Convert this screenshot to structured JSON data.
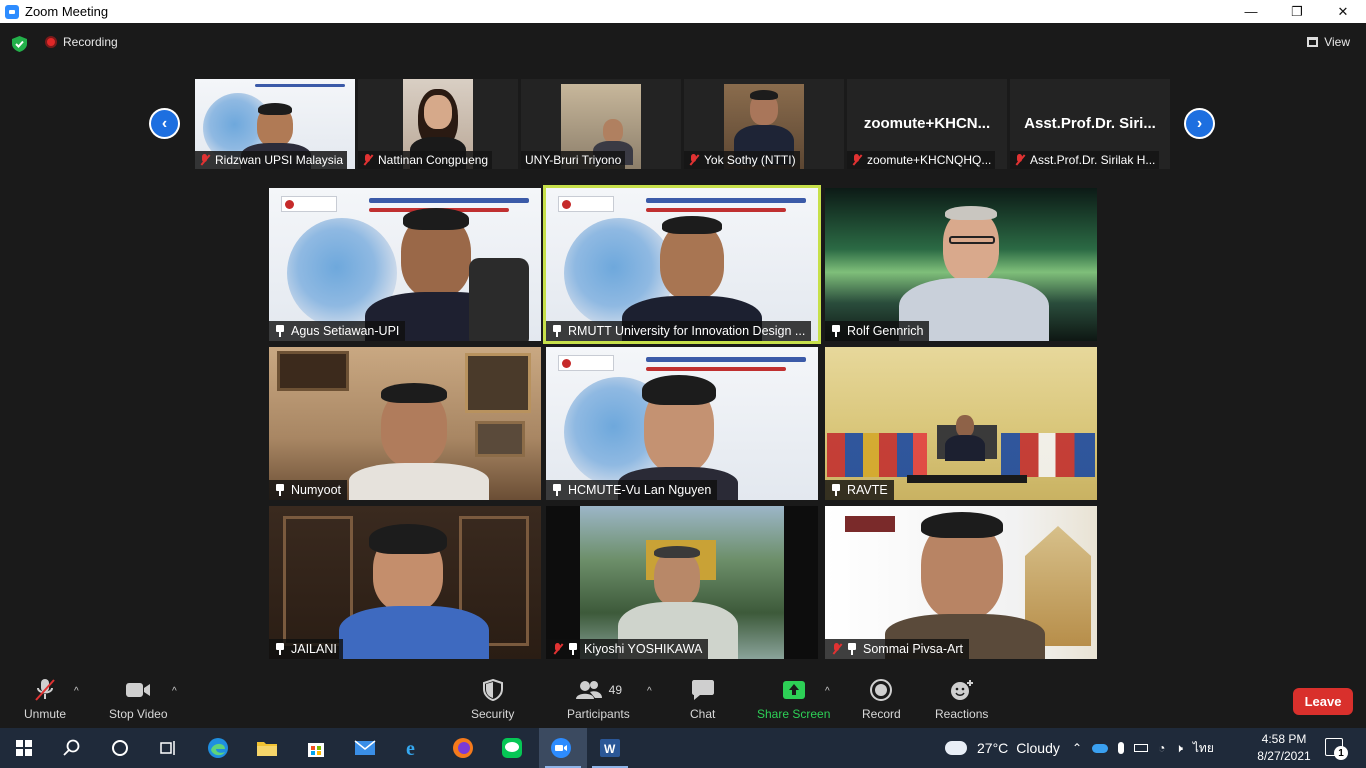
{
  "window": {
    "title": "Zoom Meeting",
    "controls": [
      "—",
      "❐",
      "✕"
    ]
  },
  "topbar": {
    "recording_label": "Recording",
    "view_label": "View"
  },
  "filmstrip": [
    {
      "name": "Ridzwan UPSI Malaysia",
      "muted": true
    },
    {
      "name": "Nattinan Congpueng",
      "muted": true
    },
    {
      "name": "UNY-Bruri Triyono",
      "muted": false
    },
    {
      "name": "Yok Sothy (NTTI)",
      "muted": true
    },
    {
      "name": "zoomute+KHCNQHQ...",
      "big_name": "zoomute+KHCN...",
      "muted": true
    },
    {
      "name": "Asst.Prof.Dr. Sirilak H...",
      "big_name": "Asst.Prof.Dr. Siri...",
      "muted": true
    }
  ],
  "tiles": [
    {
      "name": "Agus Setiawan-UPI",
      "muted": false
    },
    {
      "name": "RMUTT University for Innovation Design ...",
      "muted": false,
      "active": true
    },
    {
      "name": "Rolf Gennrich",
      "muted": false
    },
    {
      "name": "Numyoot",
      "muted": false
    },
    {
      "name": "HCMUTE-Vu Lan Nguyen",
      "muted": false
    },
    {
      "name": "RAVTE",
      "muted": false
    },
    {
      "name": "JAILANI",
      "muted": false
    },
    {
      "name": "Kiyoshi YOSHIKAWA",
      "muted": true
    },
    {
      "name": "Sommai Pivsa-Art",
      "muted": true
    }
  ],
  "toolbar": {
    "unmute": "Unmute",
    "stop_video": "Stop Video",
    "security": "Security",
    "participants": "Participants",
    "participant_count": "49",
    "chat": "Chat",
    "share_screen": "Share Screen",
    "record": "Record",
    "reactions": "Reactions",
    "leave": "Leave"
  },
  "taskbar": {
    "weather_temp": "27°C",
    "weather_desc": "Cloudy",
    "language": "ไทย",
    "time": "4:58 PM",
    "date": "8/27/2021",
    "notification_count": "1"
  },
  "colors": {
    "zoom_blue": "#2d8cff",
    "active_speaker": "#c7e04a",
    "share_green": "#2dd056",
    "leave_red": "#d9302c",
    "muted_red": "#e03232"
  }
}
